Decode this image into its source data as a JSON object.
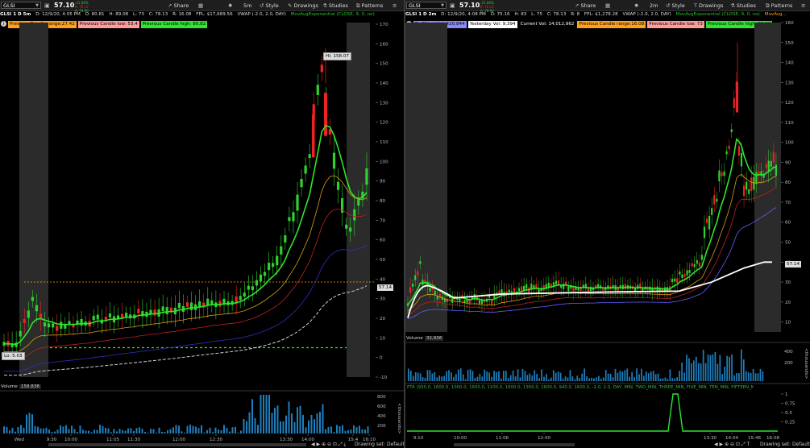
{
  "left": {
    "symbol": "GLSI",
    "last": "57.10",
    "ticker_change": "-21.06%",
    "ticker_bid": "B: 78.12",
    "ticker_ask": "A: 78.90",
    "toolbar": {
      "share": "Share",
      "timeframe": "5m",
      "style": "Style",
      "drawings": "Drawings",
      "studies": "Studies",
      "patterns": "Patterns"
    },
    "info": {
      "header": "GLSI 1 D 5m",
      "date": "D: 12/9/20, 4:05 PM",
      "open": "O: 80.81",
      "high": "H: 89.08",
      "low": "L: 73",
      "close": "C: 78.13",
      "range": "R: 16.08",
      "fpl": "FPL: $17,689.56",
      "vwap": "VWAP (-2.0, 2.0, DAY)",
      "ma": "MovAvgExponential (CLOSE, 9, 0, no)"
    },
    "labels": [
      {
        "text": "Previous Candle range:27.42",
        "color": "#ff9f1a"
      },
      {
        "text": "Previous Candle low: 53.4",
        "color": "#ff9a9a"
      },
      {
        "text": "Previous Candle high: 80.82",
        "color": "#2ee62e"
      }
    ],
    "price_axis": [
      "170",
      "160",
      "150",
      "140",
      "130",
      "120",
      "110",
      "100",
      "90",
      "80",
      "70",
      "60",
      "50",
      "40",
      "30",
      "20",
      "10",
      "0",
      "-10"
    ],
    "hi_bubble": "Hi: 158.07",
    "lo_bubble": "Lo: 5.03",
    "last_tag": "57.14",
    "volume_label": "Volume",
    "volume_value": "158,838",
    "volume_axis": [
      "800",
      "600",
      "400",
      "200"
    ],
    "volume_unit": "<thousands>",
    "time_axis": [
      "Wed",
      "9:30",
      "10:00",
      "11:05",
      "11:30",
      "12:00",
      "12:30",
      "13:30",
      "14:00",
      "15:4",
      "16:10"
    ],
    "drawing_set": "Drawing set: Default"
  },
  "right": {
    "symbol": "GLSI",
    "last": "57.10",
    "ticker_change": "-21.06%",
    "ticker_bid": "B: 78.12",
    "ticker_ask": "A: 78.90",
    "toolbar": {
      "share": "Share",
      "timeframe": "2m",
      "style": "Style",
      "drawings": "Drawings",
      "studies": "Studies",
      "patterns": "Patterns"
    },
    "info": {
      "header": "GLSI 1 D 2m",
      "date": "D: 12/9/20, 4:08 PM",
      "open": "O: 75.16",
      "high": "H: 83",
      "low": "L: 75",
      "close": "C: 78.13",
      "range": "R: 8",
      "fpl": "FPL: $1,278.28",
      "vwap": "VWAP (-2.0, 2.0, DAY)",
      "ma": "MovAvgExponential (CLOSE, 9, 0, no)",
      "ma2": "MovAvg..."
    },
    "labels": [
      {
        "text": "PreMrket Vol: 420,844",
        "color": "#8a8aff"
      },
      {
        "text": "Yesterday Vol: 9,394",
        "color": "#ffffff"
      },
      {
        "text": "Current Vol: 14,012,962",
        "color": "#000000",
        "fg": "#ffffff"
      },
      {
        "text": "Previous Candle range:16.08",
        "color": "#ff9f1a"
      },
      {
        "text": "Previous Candle low: 73",
        "color": "#ff9a9a"
      },
      {
        "text": "Previous Candle high: 89.08",
        "color": "#2ee62e"
      }
    ],
    "price_axis": [
      "160",
      "150",
      "140",
      "130",
      "120",
      "110",
      "100",
      "90",
      "80",
      "70",
      "60",
      "50",
      "40",
      "30",
      "20",
      "10"
    ],
    "last_tag": "57.14",
    "volume_label": "Volume",
    "volume_value": "32,936",
    "volume_axis": [
      "400",
      "200"
    ],
    "volume_unit": "<thousands>",
    "pta_label": "PTA (930.0, 1600.0, 1000.0, 1600.0, 1100.0, 1600.0, 1300.0, 1600.0, 940.0, 1600.0, -2.0, 2.0, DAY, MIN, TWO_MIN, THREE_MIN, FIVE_MIN, TEN_MIN, FIFTEEN_MIN,...",
    "pta_axis": [
      "1",
      "0.75",
      "0.5",
      "0.25"
    ],
    "time_axis": [
      "9:10",
      "10:00",
      "11:06",
      "12:00",
      "13:30",
      "14:04",
      "15:46",
      "16:08"
    ],
    "drawing_set": "Drawing set: Default"
  }
}
